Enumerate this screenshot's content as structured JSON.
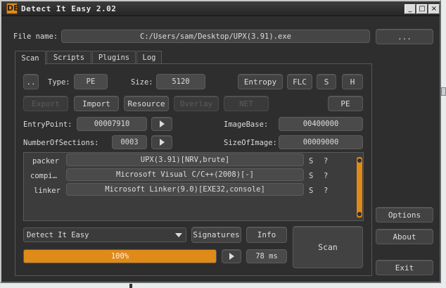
{
  "window": {
    "title": "Detect It Easy 2.02",
    "icon_text": "DE"
  },
  "file": {
    "label": "File name:",
    "path": "C:/Users/sam/Desktop/UPX(3.91).exe",
    "browse_label": "..."
  },
  "tabs": [
    "Scan",
    "Scripts",
    "Plugins",
    "Log"
  ],
  "scan": {
    "up_label": "..",
    "type_label": "Type:",
    "type_value": "PE",
    "size_label": "Size:",
    "size_value": "5120",
    "entropy_label": "Entropy",
    "flc_label": "FLC",
    "s_label": "S",
    "h_label": "H",
    "export_label": "Export",
    "import_label": "Import",
    "resource_label": "Resource",
    "overlay_label": "Overlay",
    "net_label": "NET",
    "pe_label": "PE",
    "entrypoint_label": "EntryPoint:",
    "entrypoint_value": "00007910",
    "imagebase_label": "ImageBase:",
    "imagebase_value": "00400000",
    "sections_label": "NumberOfSections:",
    "sections_value": "0003",
    "sizeofimage_label": "SizeOfImage:",
    "sizeofimage_value": "00009000",
    "arrow_glyph": ">"
  },
  "results": [
    {
      "kind": "packer",
      "name": "UPX(3.91)[NRV,brute]",
      "s": "S",
      "q": "?"
    },
    {
      "kind": "compi…",
      "name": "Microsoft Visual C/C++(2008)[-]",
      "s": "S",
      "q": "?"
    },
    {
      "kind": "linker",
      "name": "Microsoft Linker(9.0)[EXE32,console]",
      "s": "S",
      "q": "?"
    }
  ],
  "bottom": {
    "engine": "Detect It Easy",
    "signatures_label": "Signatures",
    "info_label": "Info",
    "scan_label": "Scan",
    "progress_text": "100%",
    "progress_value": 1.0,
    "time_text": "78 ms",
    "arrow_glyph": ">"
  },
  "side": {
    "options_label": "Options",
    "about_label": "About",
    "exit_label": "Exit"
  },
  "colors": {
    "accent": "#e08a17",
    "background": "#2e2e2e",
    "field": "#4a4a4a"
  }
}
